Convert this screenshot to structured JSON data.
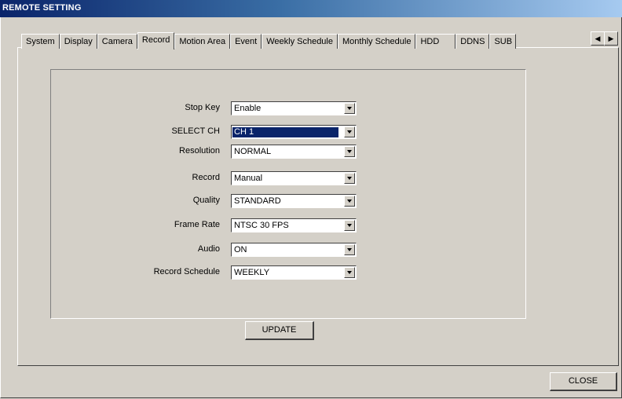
{
  "window": {
    "title": "REMOTE SETTING"
  },
  "tabs": [
    "System",
    "Display",
    "Camera",
    "Record",
    "Motion Area",
    "Event",
    "Weekly Schedule",
    "Monthly Schedule",
    "HDD",
    "DDNS",
    "SUB"
  ],
  "active_tab": "Record",
  "form": {
    "fields": [
      {
        "label": "Stop Key",
        "value": "Enable"
      },
      {
        "label": "SELECT CH",
        "value": "CH 1"
      },
      {
        "label": "Resolution",
        "value": "NORMAL"
      },
      {
        "label": "Record",
        "value": "Manual"
      },
      {
        "label": "Quality",
        "value": "STANDARD"
      },
      {
        "label": "Frame Rate",
        "value": "NTSC 30 FPS"
      },
      {
        "label": "Audio",
        "value": "ON"
      },
      {
        "label": "Record Schedule",
        "value": "WEEKLY"
      }
    ]
  },
  "buttons": {
    "update": "UPDATE",
    "close": "CLOSE"
  },
  "icons": {
    "tab_prev": "left-arrow-icon",
    "tab_next": "right-arrow-icon",
    "combo": "chevron-down-icon"
  },
  "colors": {
    "titlebar": "#0a246a",
    "face": "#d4d0c8",
    "selection": "#0a246a"
  }
}
